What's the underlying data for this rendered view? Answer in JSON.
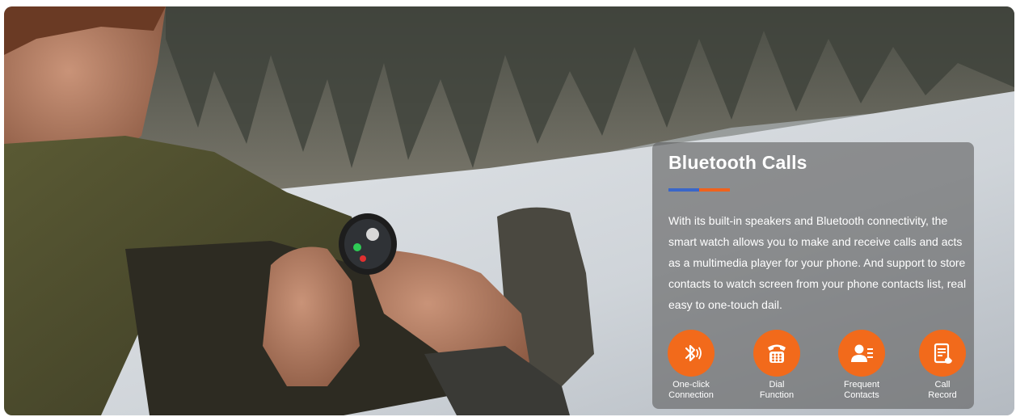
{
  "banner": {
    "title": "Bluetooth Calls",
    "description": "With its built-in speakers and Bluetooth connectivity, the smart watch allows you to make and receive calls and acts as a multimedia player for your phone. And support to store contacts to watch screen from your phone contacts list, real easy to one-touch dail.",
    "underline_colors": [
      "#3a66c9",
      "#f0621c"
    ],
    "accent_color": "#f26a1b",
    "features": [
      {
        "icon": "bluetooth-icon",
        "label": "One-click\nConnection"
      },
      {
        "icon": "telephone-keypad-icon",
        "label": "Dial\nFunction"
      },
      {
        "icon": "contact-list-icon",
        "label": "Frequent\nContacts"
      },
      {
        "icon": "call-record-icon",
        "label": "Call\nRecord"
      }
    ]
  }
}
